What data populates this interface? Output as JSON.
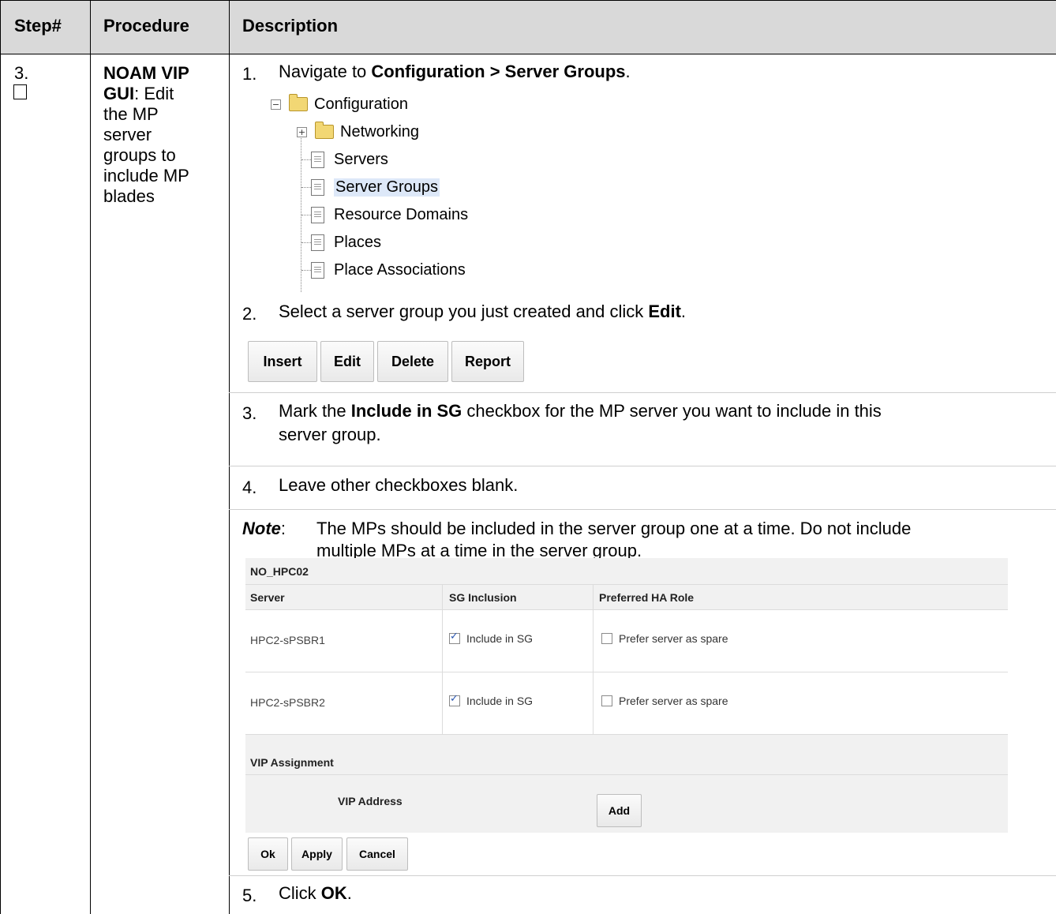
{
  "table": {
    "headers": {
      "step": "Step#",
      "procedure": "Procedure",
      "description": "Description"
    },
    "step_number": "3.",
    "procedure_title": "NOAM VIP GUI",
    "procedure_lines": [
      "NOAM VIP",
      "GUI: Edit",
      "the MP",
      "server",
      "groups to",
      "include MP",
      "blades"
    ]
  },
  "steps": {
    "s1": {
      "num": "1.",
      "pre": "Navigate to ",
      "bold": "Configuration > Server Groups",
      "post": "."
    },
    "s2": {
      "num": "2.",
      "pre": "Select a server group you just created and click ",
      "bold": "Edit",
      "post": "."
    },
    "s3": {
      "num": "3.",
      "pre": "Mark the ",
      "bold": "Include in SG",
      "post_line1": " checkbox for the MP server you want to include in this",
      "line2": "server group."
    },
    "s4": {
      "num": "4.",
      "text": "Leave other checkboxes blank."
    },
    "note": {
      "label": "Note",
      "colon": ":",
      "line1": "The MPs should be included in the server group one at a time.  Do not include",
      "line2": "multiple MPs at a time in the server group."
    },
    "s5": {
      "num": "5.",
      "pre": "Click ",
      "bold": "OK",
      "post": "."
    }
  },
  "tree": {
    "root": "Configuration",
    "networking": "Networking",
    "items": [
      "Servers",
      "Server Groups",
      "Resource Domains",
      "Places",
      "Place Associations"
    ]
  },
  "toolbar": {
    "insert": "Insert",
    "edit": "Edit",
    "delete": "Delete",
    "report": "Report"
  },
  "form": {
    "group_name": "NO_HPC02",
    "col_server": "Server",
    "col_sg": "SG Inclusion",
    "col_ha": "Preferred HA Role",
    "rows": [
      {
        "server": "HPC2-sPSBR1",
        "include": "Include in SG",
        "include_checked": true,
        "spare": "Prefer server as spare",
        "spare_checked": false
      },
      {
        "server": "HPC2-sPSBR2",
        "include": "Include in SG",
        "include_checked": true,
        "spare": "Prefer server as spare",
        "spare_checked": false
      }
    ],
    "vip_title": "VIP Assignment",
    "vip_label": "VIP Address",
    "add": "Add",
    "ok": "Ok",
    "apply": "Apply",
    "cancel": "Cancel"
  }
}
